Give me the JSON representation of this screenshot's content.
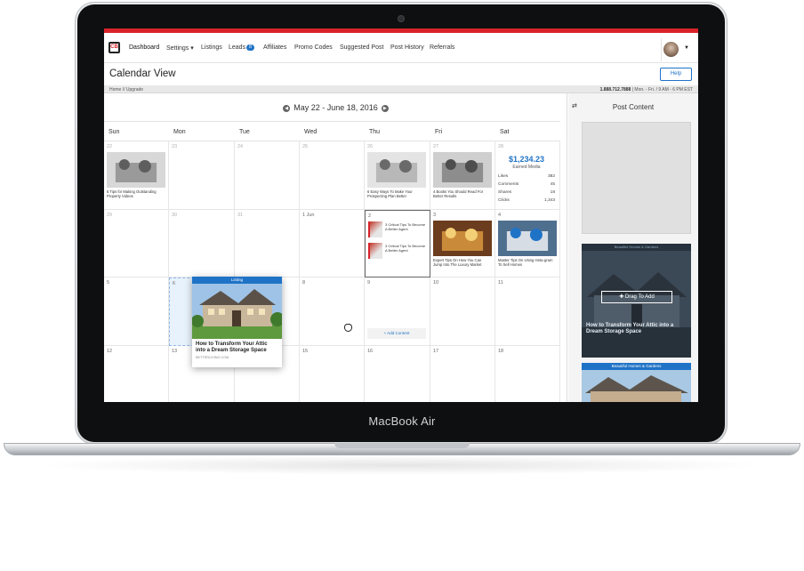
{
  "device": {
    "brand": "MacBook Air"
  },
  "nav": {
    "logo": "CB",
    "items": [
      {
        "label": "Dashboard",
        "badge": ""
      },
      {
        "label": "Settings ▾",
        "badge": ""
      },
      {
        "label": "Listings",
        "badge": ""
      },
      {
        "label": "Leads",
        "badge": "8"
      },
      {
        "label": "Affiliates",
        "badge": ""
      },
      {
        "label": "Promo Codes",
        "badge": ""
      },
      {
        "label": "Suggested Post",
        "badge": ""
      },
      {
        "label": "Post History",
        "badge": ""
      },
      {
        "label": "Referrals",
        "badge": ""
      }
    ]
  },
  "page": {
    "title": "Calendar View",
    "help_label": "Help",
    "breadcrumb": "Home // Upgrade",
    "phone": "1.888.712.7888",
    "hours": " | Mon. - Fri. / 9 AM - 6 PM EST"
  },
  "calendar": {
    "range": "May 22 - June 18, 2016",
    "prev_icon": "chevron-left-icon",
    "next_icon": "chevron-right-icon",
    "days": [
      "Sun",
      "Mon",
      "Tue",
      "Wed",
      "Thu",
      "Fri",
      "Sat"
    ],
    "weeks": [
      [
        "22",
        "23",
        "24",
        "25",
        "26",
        "27",
        "28"
      ],
      [
        "29",
        "30",
        "31",
        "1 Jun",
        "2",
        "3",
        "4"
      ],
      [
        "5",
        "6",
        "7",
        "8",
        "9",
        "10",
        "11"
      ],
      [
        "12",
        "13",
        "14",
        "15",
        "16",
        "17",
        "18"
      ]
    ],
    "posts": {
      "sun22": "5 Tips for Making Outstanding Property Videos",
      "thu26": "6 Easy Ways To Make Your Prospecting Plan Better",
      "fri27": "4 Books You Should Read For Better Results",
      "thu2a": "3 Critical Tips To Become A Better Agent",
      "thu2b": "3 Critical Tips To Become A Better Agent",
      "fri3": "Expert Tips On How You Can Jump Into The Luxury Market",
      "sat4": "Master Tips On Using Insta-gram To Sell Homes"
    },
    "add_content_label": "+ Add Content",
    "earned": {
      "value": "$1,234.23",
      "label": "Earned Media",
      "stats": [
        {
          "label": "Likes",
          "value": "382"
        },
        {
          "label": "Comments",
          "value": "45"
        },
        {
          "label": "Shares",
          "value": "18"
        },
        {
          "label": "Clicks",
          "value": "1,343"
        }
      ]
    }
  },
  "drag_card": {
    "tag": "Listing",
    "title": "How to Transform Your Attic into a Dream Storage Space",
    "source": "BETTERLIVING.COM"
  },
  "side": {
    "title": "Post Content",
    "card1": {
      "tag": "Beautiful Homes & Gardens",
      "drag_label": "✚ Drag To Add",
      "title": "How to Transform Your Attic into a Dream Storage Space"
    },
    "card2": {
      "tag": "Beautiful Homes & Gardens"
    }
  },
  "colors": {
    "brand_red": "#d8232a",
    "accent_blue": "#1f73c7"
  }
}
